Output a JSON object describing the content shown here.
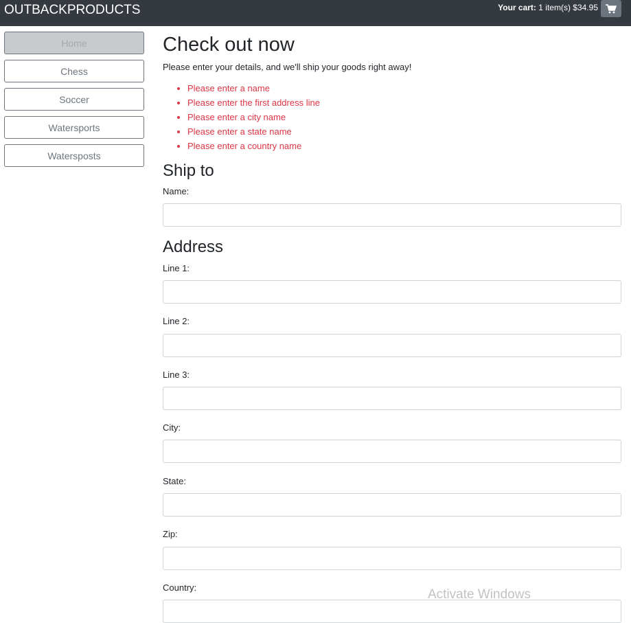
{
  "navbar": {
    "brand": "OUTBACKPRODUCTS",
    "cart_label": "Your cart:",
    "cart_summary": "1 item(s) $34.95",
    "cart_icon": "shopping-cart-icon"
  },
  "sidebar": {
    "items": [
      {
        "label": "Home",
        "active": true
      },
      {
        "label": "Chess",
        "active": false
      },
      {
        "label": "Soccer",
        "active": false
      },
      {
        "label": "Watersports",
        "active": false
      },
      {
        "label": "Watersposts",
        "active": false
      }
    ]
  },
  "checkout": {
    "title": "Check out now",
    "subtitle": "Please enter your details, and we'll ship your goods right away!",
    "errors": [
      "Please enter a name",
      "Please enter the first address line",
      "Please enter a city name",
      "Please enter a state name",
      "Please enter a country name"
    ],
    "ship_to_heading": "Ship to",
    "name_label": "Name:",
    "address_heading": "Address",
    "line1_label": "Line 1:",
    "line2_label": "Line 2:",
    "line3_label": "Line 3:",
    "city_label": "City:",
    "state_label": "State:",
    "zip_label": "Zip:",
    "country_label": "Country:"
  },
  "watermark": "Activate Windows",
  "colors": {
    "navbar_bg": "#343a40",
    "error_red": "#dc3545",
    "secondary": "#6c757d"
  }
}
